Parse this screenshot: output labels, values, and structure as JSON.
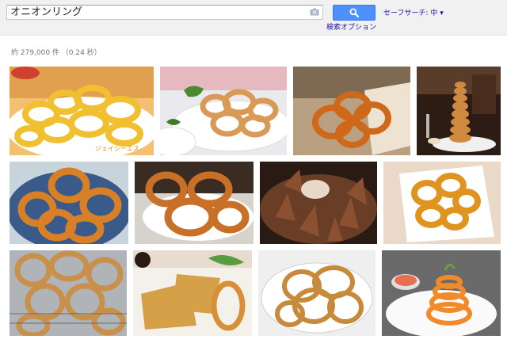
{
  "search": {
    "query": "オニオンリング",
    "button_icon": "search-icon",
    "camera_icon": "camera-icon",
    "advanced_link": "検索オプション",
    "safesearch": "セーフサーチ: 中 ▾"
  },
  "stats": "約 279,000 件 （0.24 秒）",
  "colors": {
    "accent_blue": "#4d90fe",
    "link_blue": "#1a0dab",
    "stats_gray": "#777777"
  },
  "results": [
    {
      "subject": "onion rings on white plate",
      "caption": "ジェイシーエス"
    },
    {
      "subject": "onion rings in bowl"
    },
    {
      "subject": "onion rings on paper"
    },
    {
      "subject": "onion ring tower"
    },
    {
      "subject": "onion rings in bowl"
    },
    {
      "subject": "onion rings on plate"
    },
    {
      "subject": "onion bloom with sauce"
    },
    {
      "subject": "onion rings on square plate"
    },
    {
      "subject": "fried onion rings on rack"
    },
    {
      "subject": "fried cutlets with onion rings"
    },
    {
      "subject": "tempura onion rings"
    },
    {
      "subject": "onion rings tower with sauce"
    }
  ]
}
